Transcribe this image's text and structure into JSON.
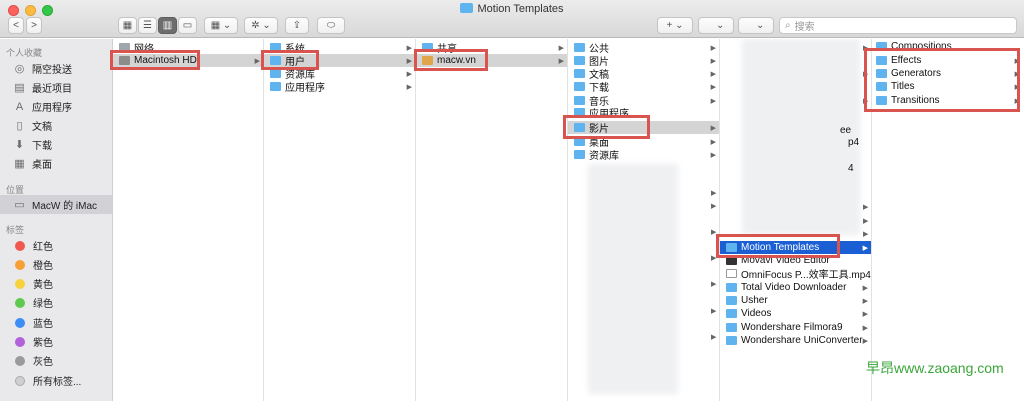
{
  "window": {
    "title": "Motion Templates"
  },
  "toolbar": {
    "back": "<",
    "forward": ">",
    "add": "+",
    "search_placeholder": "搜索"
  },
  "sidebar": {
    "favorites_heading": "个人收藏",
    "favorites": [
      {
        "label": "隔空投送",
        "icon": "airdrop-icon"
      },
      {
        "label": "最近项目",
        "icon": "recents-icon"
      },
      {
        "label": "应用程序",
        "icon": "applications-icon"
      },
      {
        "label": "文稿",
        "icon": "document-icon"
      },
      {
        "label": "下载",
        "icon": "download-icon"
      },
      {
        "label": "桌面",
        "icon": "desktop-icon"
      }
    ],
    "locations_heading": "位置",
    "locations": [
      {
        "label": "MacW 的 iMac",
        "icon": "computer-icon"
      }
    ],
    "tags_heading": "标签",
    "tags": [
      {
        "label": "红色",
        "color": "#f0584f"
      },
      {
        "label": "橙色",
        "color": "#f7a035"
      },
      {
        "label": "黄色",
        "color": "#f8d23c"
      },
      {
        "label": "绿色",
        "color": "#5ec94f"
      },
      {
        "label": "蓝色",
        "color": "#3c8ef5"
      },
      {
        "label": "紫色",
        "color": "#b162d8"
      },
      {
        "label": "灰色",
        "color": "#9a9a9a"
      },
      {
        "label": "所有标签...",
        "color": "#d0d0d0"
      }
    ]
  },
  "columns": {
    "c1": [
      "网络",
      "Macintosh HD"
    ],
    "c2": [
      "系统",
      "用户",
      "资源库",
      "应用程序"
    ],
    "c3": [
      "共享",
      "macw.vn"
    ],
    "c4": [
      "公共",
      "图片",
      "文稿",
      "下载",
      "音乐",
      "应用程序",
      "影片",
      "桌面",
      "资源库"
    ],
    "c5": [
      "Motion Templates",
      "Movavi Video Editor",
      "OmniFocus P...效率工具.mp4",
      "Total Video Downloader",
      "Usher",
      "Videos",
      "Wondershare Filmora9",
      "Wondershare UniConverter"
    ],
    "c5_partial": [
      "ee",
      "p4",
      "4"
    ],
    "c6": [
      "Compositions",
      "Effects",
      "Generators",
      "Titles",
      "Transitions"
    ]
  },
  "watermark": "早昂www.zaoang.com"
}
